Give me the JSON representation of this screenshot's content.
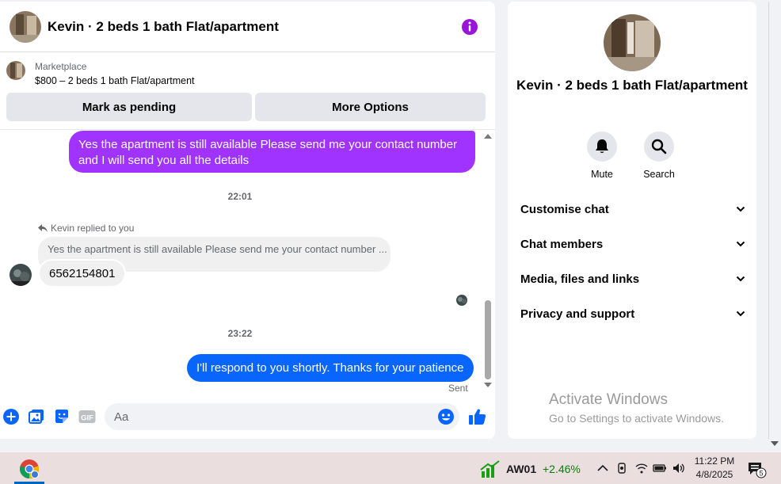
{
  "header": {
    "title": "Kevin · 2 beds 1 bath Flat/apartment",
    "info_icon": "info-icon"
  },
  "marketplace": {
    "label": "Marketplace",
    "listing": "$800 – 2 beds 1 bath Flat/apartment",
    "mark_pending_label": "Mark as pending",
    "more_options_label": "More Options"
  },
  "messages": {
    "outgoing_1": "Yes the apartment is still available Please send me your contact number and I will send you all the details",
    "timestamp_1": "22:01",
    "reply_note": "Kevin replied to you",
    "quoted_text": "Yes the apartment is still available Please send me your contact number ...",
    "incoming_1": "6562154801",
    "timestamp_2": "23:22",
    "outgoing_2": "I'll respond to you shortly. Thanks for your patience",
    "sent_label": "Sent"
  },
  "composer": {
    "placeholder": "Aa",
    "gif_label": "GIF"
  },
  "info_panel": {
    "name": "Kevin · 2 beds 1 bath Flat/apartment",
    "mute_label": "Mute",
    "search_label": "Search",
    "sections": [
      "Customise chat",
      "Chat members",
      "Media, files and links",
      "Privacy and support"
    ]
  },
  "watermark": {
    "line1": "Activate Windows",
    "line2": "Go to Settings to activate Windows."
  },
  "taskbar": {
    "stock_name": "AW01",
    "stock_change": "+2.46%",
    "time": "11:22 PM",
    "date": "4/8/2025",
    "notification_count": "5"
  },
  "colors": {
    "outgoing_purple": "#a033ff",
    "outgoing_blue": "#0866ff",
    "accent_blue": "#0866ff",
    "info_purple": "#9b15d9",
    "stock_green": "#0f7b0f"
  }
}
